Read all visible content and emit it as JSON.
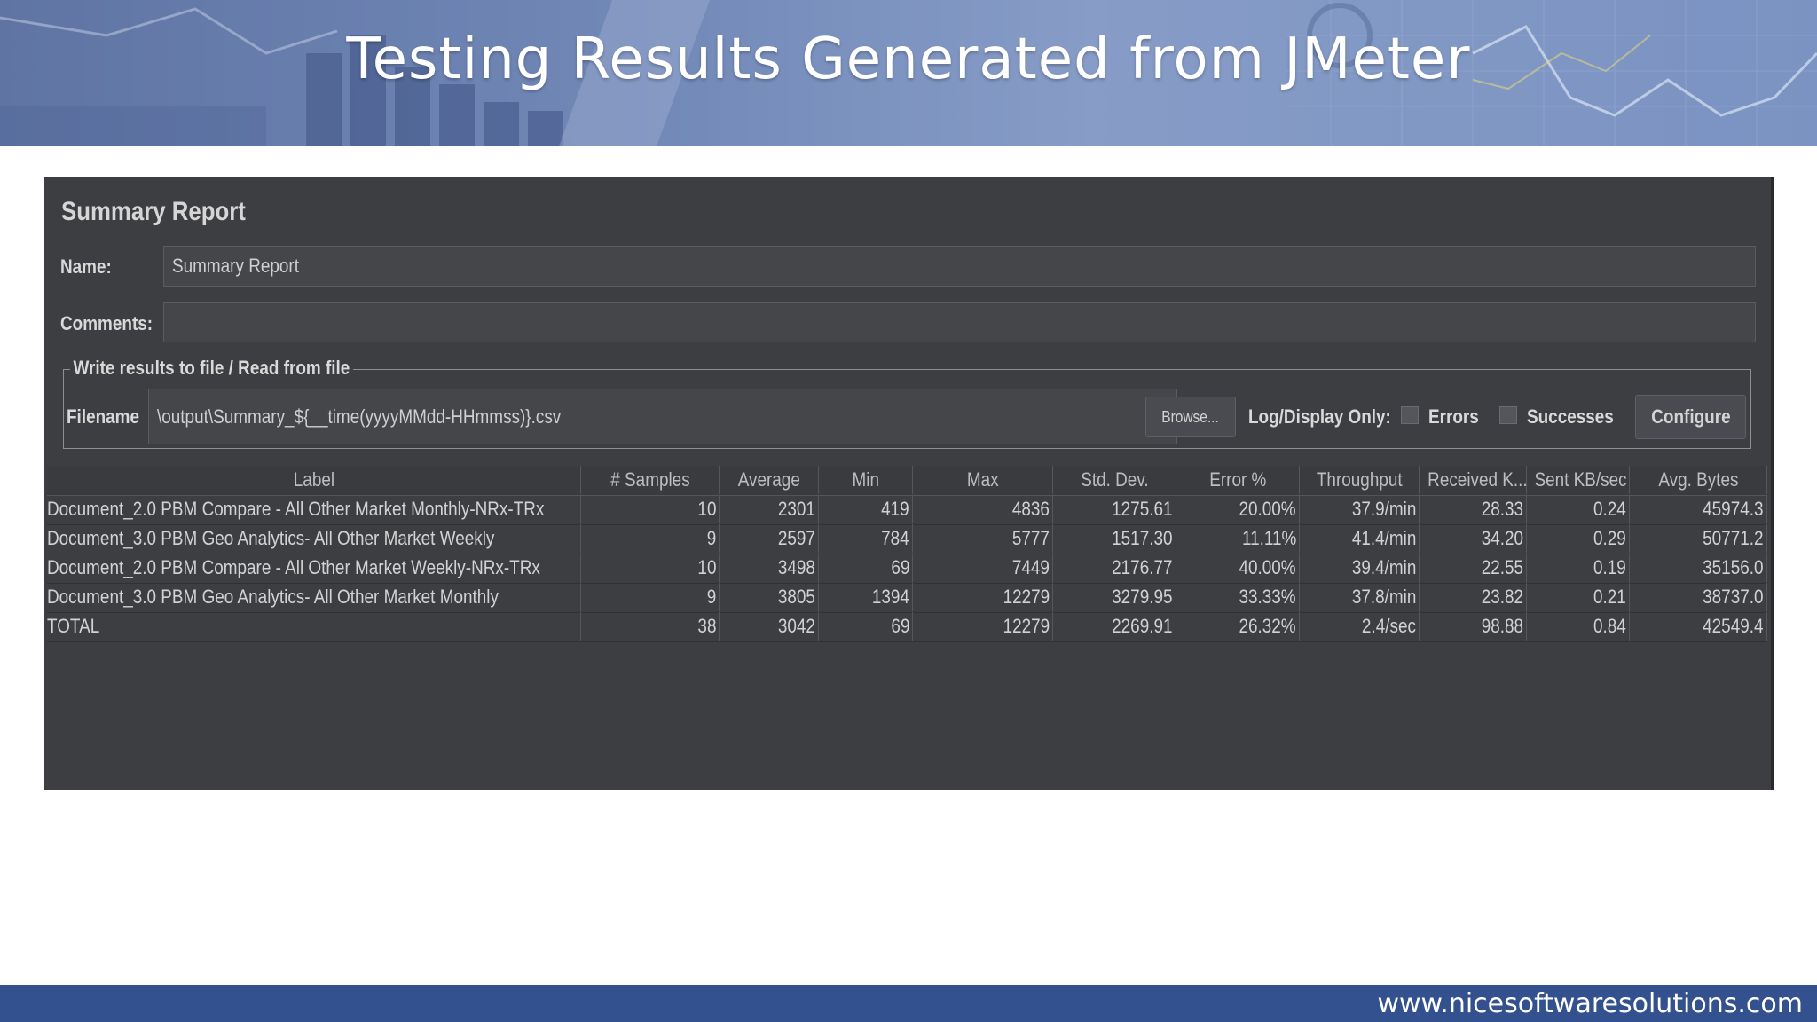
{
  "slide": {
    "title": "Testing Results Generated from JMeter",
    "footer_url": "www.nicesoftwaresolutions.com"
  },
  "report": {
    "title": "Summary Report",
    "name_label": "Name:",
    "name_value": "Summary Report",
    "comments_label": "Comments:",
    "comments_value": "",
    "file_section_label": "Write results to file / Read from file",
    "filename_label": "Filename",
    "filename_value": "\\output\\Summary_${__time(yyyyMMdd-HHmmss)}.csv",
    "browse_label": "Browse...",
    "log_display_label": "Log/Display Only:",
    "errors_label": "Errors",
    "errors_checked": false,
    "successes_label": "Successes",
    "successes_checked": false,
    "configure_label": "Configure"
  },
  "table": {
    "columns": [
      "Label",
      "# Samples",
      "Average",
      "Min",
      "Max",
      "Std. Dev.",
      "Error %",
      "Throughput",
      "Received K...",
      "Sent KB/sec",
      "Avg. Bytes"
    ],
    "rows": [
      [
        "Document_2.0 PBM Compare - All Other Market Monthly-NRx-TRx",
        "10",
        "2301",
        "419",
        "4836",
        "1275.61",
        "20.00%",
        "37.9/min",
        "28.33",
        "0.24",
        "45974.3"
      ],
      [
        "Document_3.0 PBM Geo Analytics- All Other Market Weekly",
        "9",
        "2597",
        "784",
        "5777",
        "1517.30",
        "11.11%",
        "41.4/min",
        "34.20",
        "0.29",
        "50771.2"
      ],
      [
        "Document_2.0 PBM Compare - All Other Market Weekly-NRx-TRx",
        "10",
        "3498",
        "69",
        "7449",
        "2176.77",
        "40.00%",
        "39.4/min",
        "22.55",
        "0.19",
        "35156.0"
      ],
      [
        "Document_3.0 PBM Geo Analytics- All Other Market Monthly",
        "9",
        "3805",
        "1394",
        "12279",
        "3279.95",
        "33.33%",
        "37.8/min",
        "23.82",
        "0.21",
        "38737.0"
      ],
      [
        "TOTAL",
        "38",
        "3042",
        "69",
        "12279",
        "2269.91",
        "26.32%",
        "2.4/sec",
        "98.88",
        "0.84",
        "42549.4"
      ]
    ]
  }
}
